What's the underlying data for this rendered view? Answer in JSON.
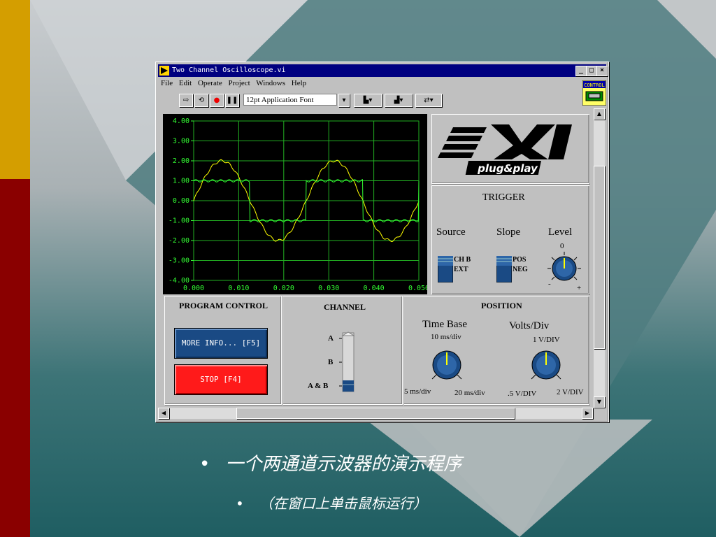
{
  "window": {
    "title": "Two Channel Oscilloscope.vi",
    "menu": [
      "File",
      "Edit",
      "Operate",
      "Project",
      "Windows",
      "Help"
    ],
    "font_selector": "12pt Application Font",
    "control_badge": "CONTROL"
  },
  "chart_data": {
    "type": "line",
    "xlim": [
      0,
      0.05
    ],
    "ylim": [
      -4,
      4
    ],
    "x_ticks": [
      "0.000",
      "0.010",
      "0.020",
      "0.030",
      "0.040",
      "0.050"
    ],
    "y_ticks": [
      "4.00",
      "3.00",
      "2.00",
      "1.00",
      "0.00",
      "-1.00",
      "-2.00",
      "-3.00",
      "-4.00"
    ],
    "grid": true,
    "series": [
      {
        "wave": "sine",
        "amplitude": 2.0,
        "period": 0.025,
        "color": "#ffff00"
      },
      {
        "wave": "square",
        "high": 1.0,
        "low": -1.0,
        "period": 0.025,
        "color": "#33ff33"
      }
    ]
  },
  "logo": {
    "text": "plug&play"
  },
  "trigger": {
    "title": "TRIGGER",
    "source_label": "Source",
    "source_options": [
      "CH B",
      "EXT"
    ],
    "slope_label": "Slope",
    "slope_options": [
      "POS",
      "NEG"
    ],
    "level_label": "Level",
    "level_zero": "0",
    "level_minus": "-",
    "level_plus": "+"
  },
  "program_control": {
    "title": "PROGRAM CONTROL",
    "more_info": "MORE INFO... [F5]",
    "stop": "STOP [F4]"
  },
  "channel": {
    "title": "CHANNEL",
    "options": [
      "A",
      "B",
      "A & B"
    ],
    "selected": "A & B"
  },
  "position": {
    "title": "POSITION",
    "time_base_label": "Time Base",
    "time_base_value": "10 ms/div",
    "time_base_min": "5 ms/div",
    "time_base_max": "20 ms/div",
    "volts_label": "Volts/Div",
    "volts_value": "1 V/DIV",
    "volts_min": ".5 V/DIV",
    "volts_max": "2 V/DIV"
  },
  "slide": {
    "bullet1": "一个两通道示波器的演示程序",
    "bullet2": "（在窗口上单击鼠标运行）",
    "bullet_mark": "•"
  }
}
